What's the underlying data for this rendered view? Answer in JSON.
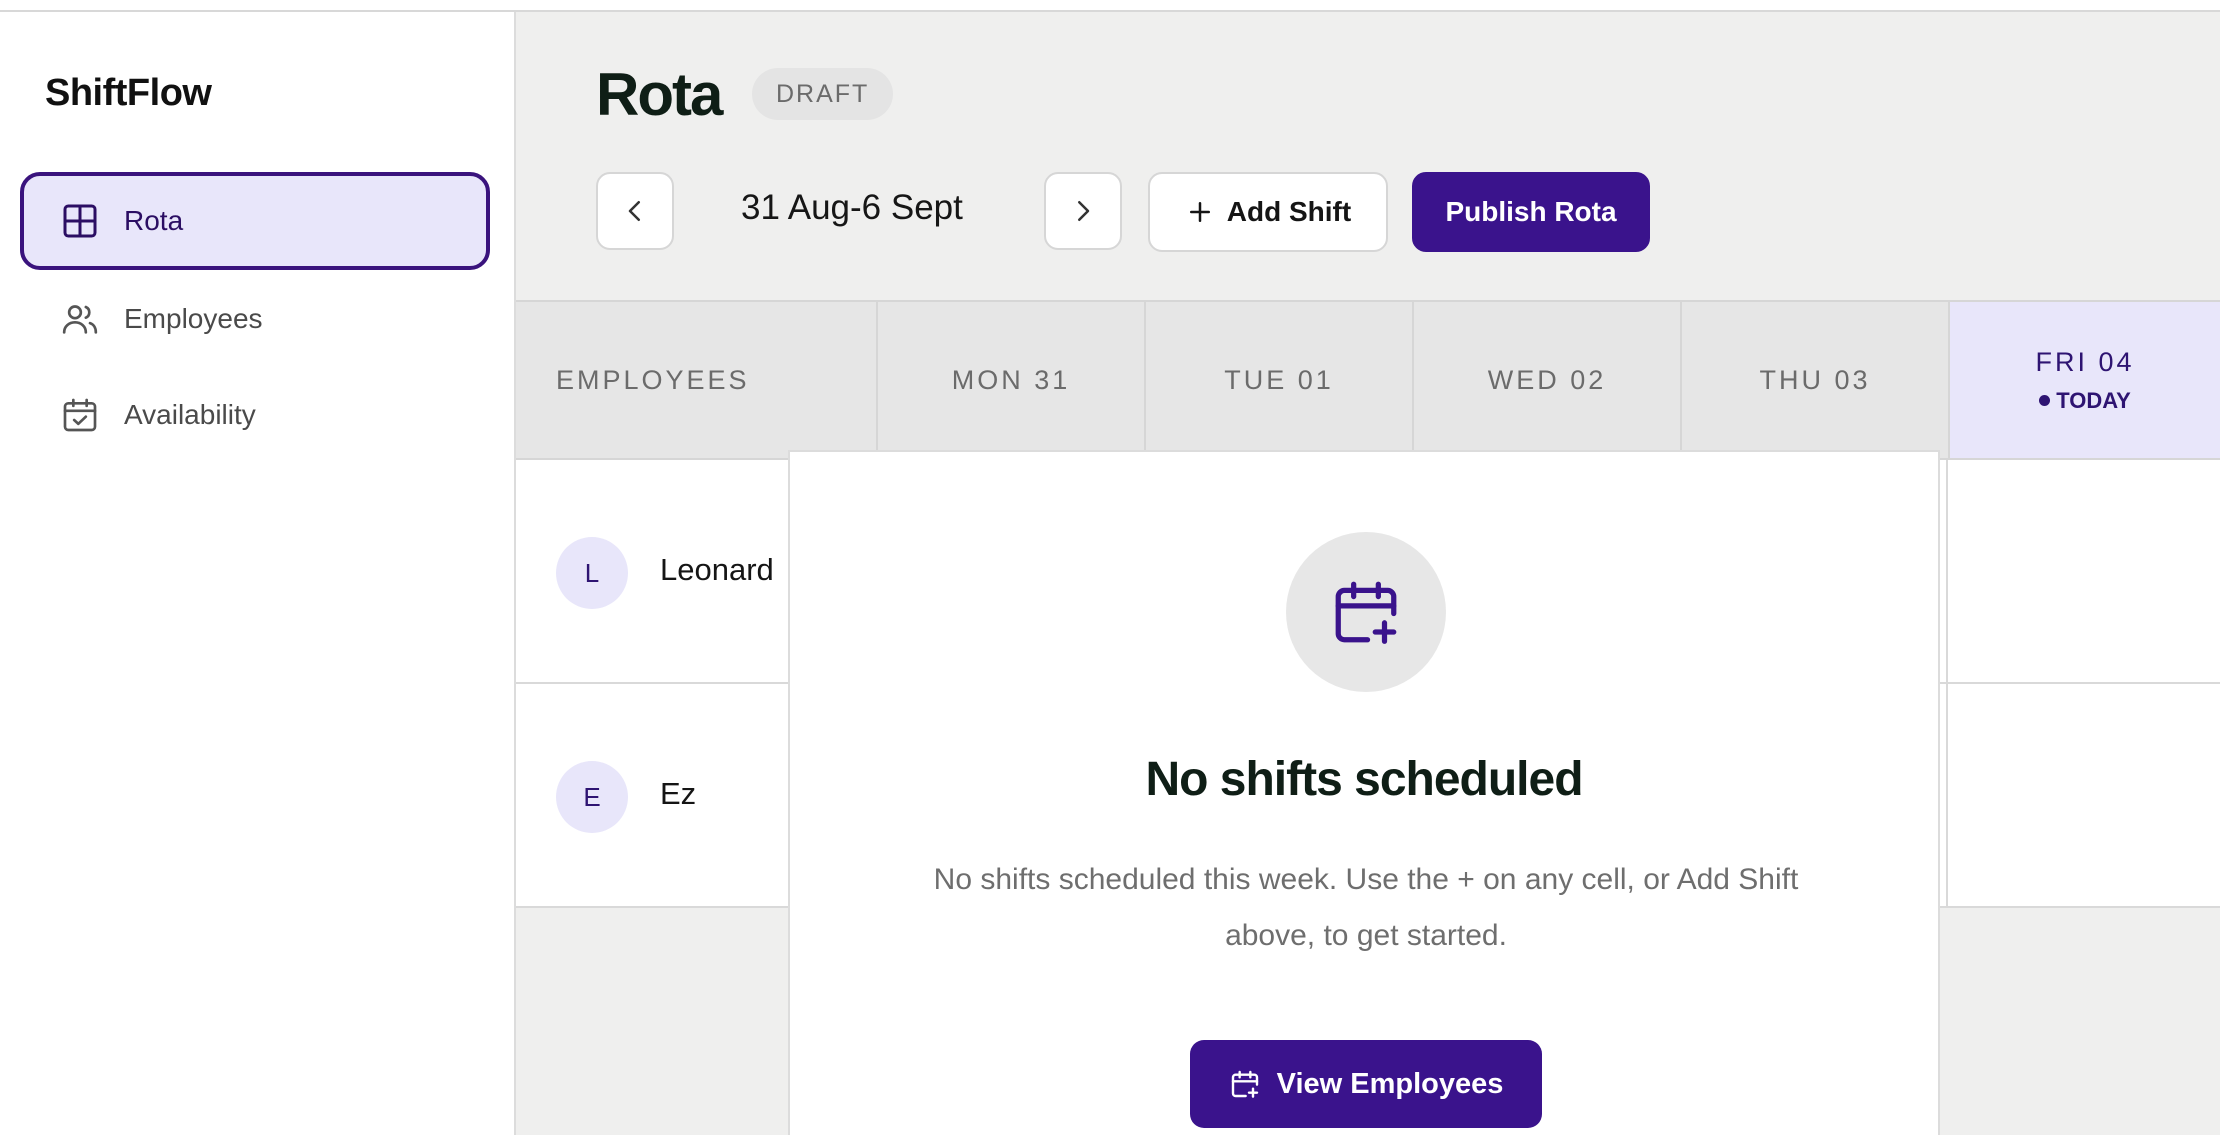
{
  "app": {
    "name": "ShiftFlow"
  },
  "sidebar": {
    "items": [
      {
        "label": "Rota",
        "icon": "grid-icon",
        "active": true
      },
      {
        "label": "Employees",
        "icon": "users-icon",
        "active": false
      },
      {
        "label": "Availability",
        "icon": "calendar-check-icon",
        "active": false
      }
    ]
  },
  "header": {
    "title": "Rota",
    "status_badge": "DRAFT",
    "date_range": "31 Aug-6 Sept",
    "add_shift_label": "Add Shift",
    "publish_label": "Publish Rota"
  },
  "grid": {
    "employees_header": "EMPLOYEES",
    "days": [
      "MON 31",
      "TUE 01",
      "WED 02",
      "THU 03",
      "FRI 04"
    ],
    "today_label": "TODAY",
    "rows": [
      {
        "initial": "L",
        "name": "Leonard"
      },
      {
        "initial": "E",
        "name": "Ez"
      }
    ]
  },
  "empty_state": {
    "title": "No shifts scheduled",
    "message": "No shifts scheduled this week. Use the + on any cell, or Add Shift above, to get started.",
    "button_label": "View Employees"
  },
  "colors": {
    "accent": "#3a138c",
    "accent_light": "#e8e6fa",
    "main_bg": "#efefee"
  }
}
